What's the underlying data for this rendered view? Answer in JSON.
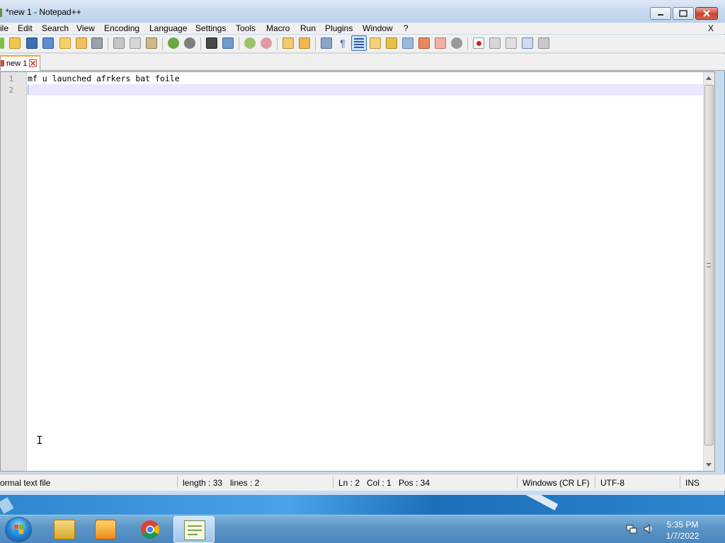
{
  "window": {
    "title": "*new 1 - Notepad++"
  },
  "menu": {
    "items": [
      "ile",
      "Edit",
      "Search",
      "View",
      "Encoding",
      "Language",
      "Settings",
      "Tools",
      "Macro",
      "Run",
      "Plugins",
      "Window",
      "?"
    ],
    "close_label": "X"
  },
  "toolbar": {
    "icons": [
      "new-file-icon",
      "open-file-icon",
      "save-icon",
      "save-all-icon",
      "close-icon",
      "close-all-icon",
      "print-icon",
      "cut-icon",
      "copy-icon",
      "paste-icon",
      "undo-icon",
      "redo-icon",
      "find-icon",
      "replace-icon",
      "zoom-in-icon",
      "zoom-out-icon",
      "sync-vertical-icon",
      "sync-horizontal-icon",
      "word-wrap-icon",
      "show-all-characters-icon",
      "indent-guide-icon",
      "doc-map-icon",
      "function-list-icon",
      "folder-workspace-icon",
      "monitoring-icon",
      "record-macro-icon",
      "stop-macro-icon",
      "play-macro-icon",
      "run-macro-multiple-icon",
      "save-macro-icon"
    ]
  },
  "tabs": [
    {
      "label": "new 1",
      "modified": true
    }
  ],
  "editor": {
    "lines": [
      {
        "number": "1",
        "text": "mf u launched afrkers bat foile"
      },
      {
        "number": "2",
        "text": ""
      }
    ]
  },
  "status": {
    "file_type": "ormal text file",
    "length": "length : 33",
    "lines": "lines : 2",
    "ln": "Ln : 2",
    "col": "Col : 1",
    "pos": "Pos : 34",
    "eol": "Windows (CR LF)",
    "encoding": "UTF-8",
    "mode": "INS"
  },
  "taskbar": {
    "apps": [
      "explorer-icon",
      "media-player-icon",
      "chrome-icon",
      "notepad-plus-plus-icon"
    ],
    "time": "5:35 PM",
    "date": "1/7/2022"
  },
  "colors": {
    "current_line": "#e8e8ff",
    "tab_accent": "#f6a52b",
    "close_button": "#c8412b"
  }
}
